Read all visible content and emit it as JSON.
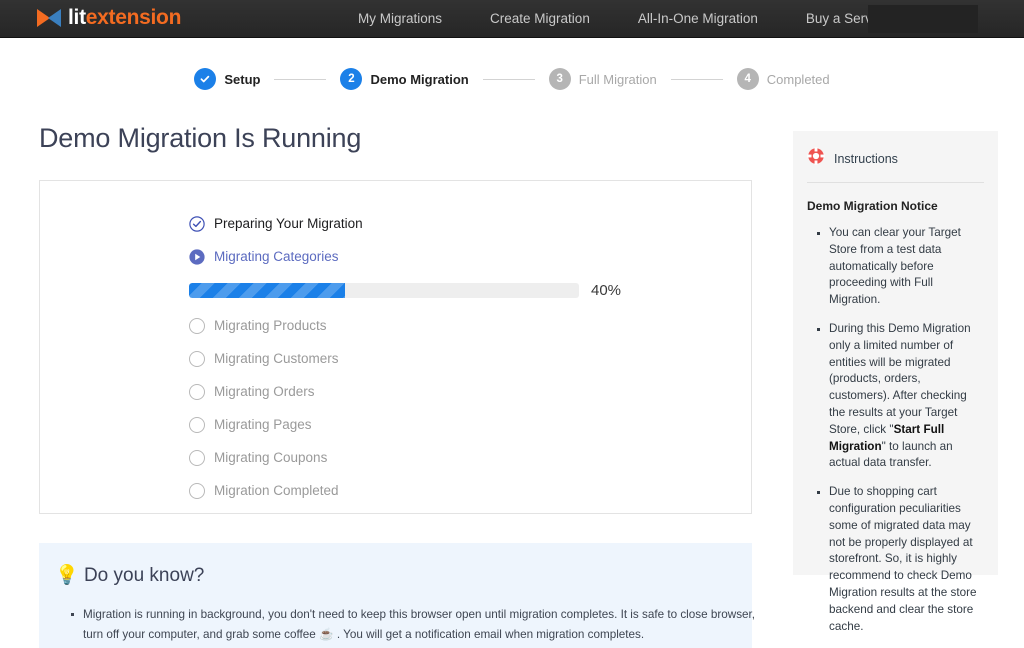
{
  "brand": {
    "logo_lit": "lit",
    "logo_ext": "extension",
    "logo_icon": "bowtie-logo-icon",
    "orange": "#f36b21",
    "blue": "#3a7fbf"
  },
  "nav": {
    "items": [
      {
        "label": "My Migrations",
        "has_caret": false
      },
      {
        "label": "Create Migration",
        "has_caret": false
      },
      {
        "label": "All-In-One Migration",
        "has_caret": false
      },
      {
        "label": "Buy a Service",
        "has_caret": true
      }
    ]
  },
  "stepper": {
    "steps": [
      {
        "number": "",
        "label": "Setup",
        "state": "done"
      },
      {
        "number": "2",
        "label": "Demo Migration",
        "state": "active"
      },
      {
        "number": "3",
        "label": "Full Migration",
        "state": "todo"
      },
      {
        "number": "4",
        "label": "Completed",
        "state": "todo"
      }
    ],
    "active_color": "#1b80e8",
    "todo_color": "#b5b5b5"
  },
  "page": {
    "title": "Demo Migration Is Running"
  },
  "migration": {
    "tasks": [
      {
        "label": "Preparing Your Migration",
        "state": "completed"
      },
      {
        "label": "Migrating Categories",
        "state": "running"
      },
      {
        "label": "Migrating Products",
        "state": "pending"
      },
      {
        "label": "Migrating Customers",
        "state": "pending"
      },
      {
        "label": "Migrating Orders",
        "state": "pending"
      },
      {
        "label": "Migrating Pages",
        "state": "pending"
      },
      {
        "label": "Migrating Coupons",
        "state": "pending"
      },
      {
        "label": "Migration Completed",
        "state": "pending"
      }
    ],
    "progress": {
      "percent": 40,
      "percent_label": "40%",
      "bar_color": "#1b80e8",
      "track_color": "#eeeeee"
    },
    "running_color": "#5c6bc0"
  },
  "know": {
    "icon": "lightbulb-icon",
    "emoji": "💡",
    "title": "Do you know?",
    "items": [
      "Migration is running in background, you don't need to keep this browser open until migration completes. It is safe to close browser, turn off your computer, and grab some coffee ☕ . You will get a notification email when migration completes."
    ],
    "background": "#eef5fd"
  },
  "instructions": {
    "icon": "lifebuoy-icon",
    "icon_color": "#ef5350",
    "header": "Instructions",
    "subtitle": "Demo Migration Notice",
    "bullets": [
      {
        "pre": "You can clear your Target Store from a test data automatically before proceeding with Full Migration.",
        "bold": "",
        "post": ""
      },
      {
        "pre": "During this Demo Migration only a limited number of entities will be migrated (products, orders, customers). After checking the results at your Target Store, click \"",
        "bold": "Start Full Migration",
        "post": "\" to launch an actual data transfer."
      },
      {
        "pre": "Due to shopping cart configuration peculiarities some of migrated data may not be properly displayed at storefront. So, it is highly recommend to check Demo Migration results at the store backend and clear the store cache.",
        "bold": "",
        "post": ""
      }
    ],
    "background": "#f5f5f5"
  }
}
